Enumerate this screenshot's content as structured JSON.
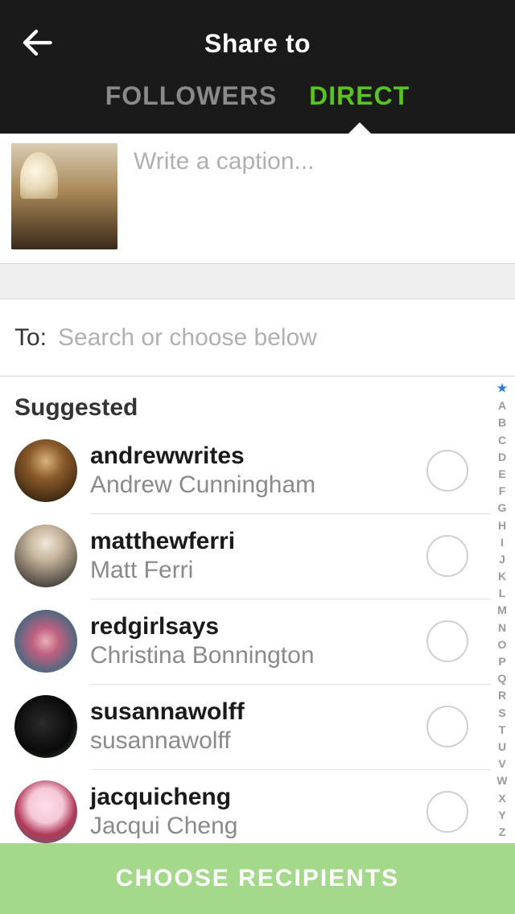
{
  "header": {
    "title": "Share to",
    "tabs": {
      "followers": "FOLLOWERS",
      "direct": "DIRECT"
    }
  },
  "caption": {
    "placeholder": "Write a caption..."
  },
  "to": {
    "label": "To:",
    "placeholder": "Search or choose below"
  },
  "section_title": "Suggested",
  "contacts": [
    {
      "username": "andrewwrites",
      "fullname": "Andrew Cunningham"
    },
    {
      "username": "matthewferri",
      "fullname": "Matt Ferri"
    },
    {
      "username": "redgirlsays",
      "fullname": "Christina Bonnington"
    },
    {
      "username": "susannawolff",
      "fullname": "susannawolff"
    },
    {
      "username": "jacquicheng",
      "fullname": "Jacqui Cheng"
    }
  ],
  "alpha_index": [
    "A",
    "B",
    "C",
    "D",
    "E",
    "F",
    "G",
    "H",
    "I",
    "J",
    "K",
    "L",
    "M",
    "N",
    "O",
    "P",
    "Q",
    "R",
    "S",
    "T",
    "U",
    "V",
    "W",
    "X",
    "Y",
    "Z"
  ],
  "footer": {
    "button": "CHOOSE RECIPIENTS"
  }
}
